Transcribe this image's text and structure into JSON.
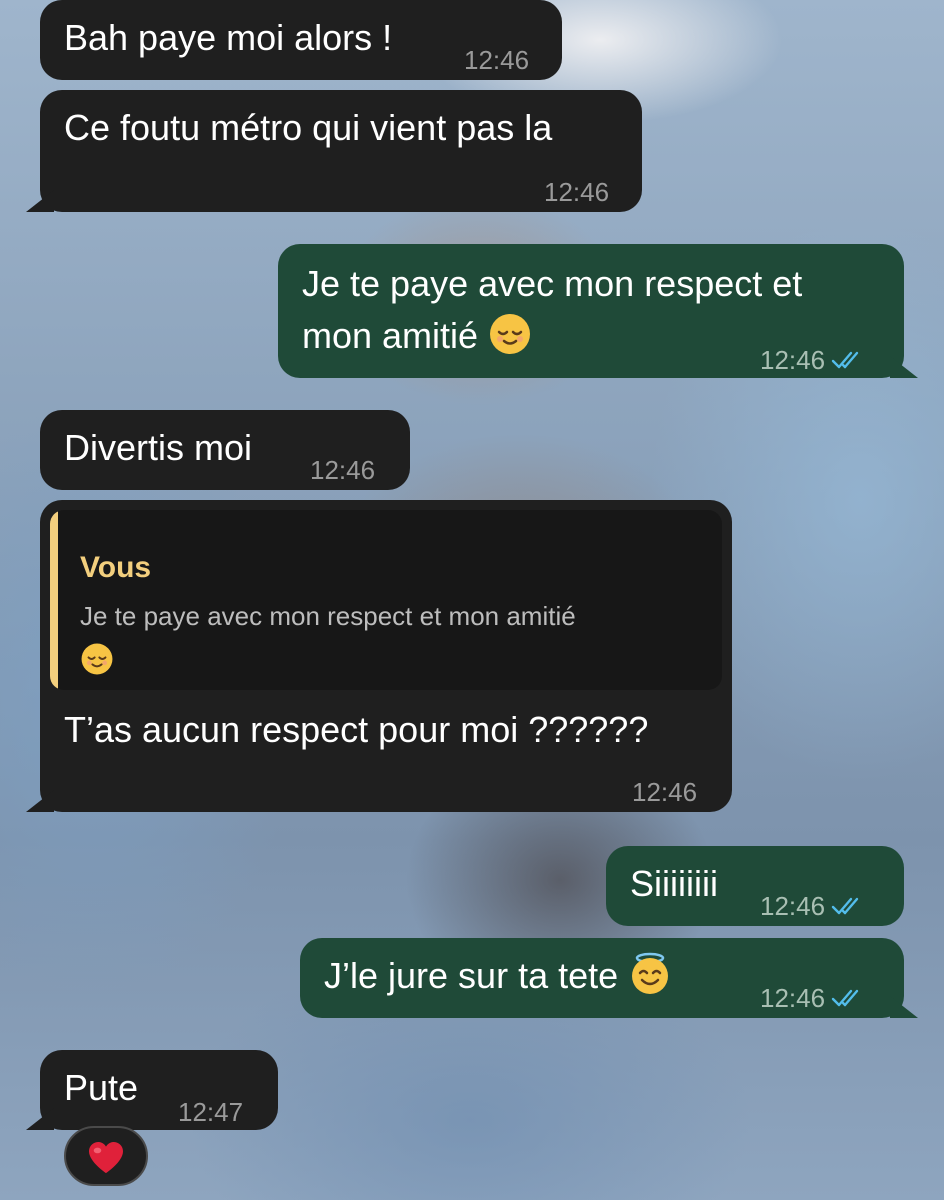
{
  "app": "WhatsApp chat",
  "colors": {
    "incoming_bubble": "#1f1f1f",
    "outgoing_bubble": "#1f4a38",
    "quote_accent": "#f3cf7e",
    "read_ticks": "#53bdeb",
    "heart": "#e0213a"
  },
  "messages": [
    {
      "direction": "in",
      "text": "Bah paye moi alors !",
      "time": "12:46"
    },
    {
      "direction": "in",
      "text": "Ce foutu métro qui vient pas la",
      "time": "12:46"
    },
    {
      "direction": "out",
      "line1": "Je te paye avec mon respect et",
      "line2": "mon amitié",
      "emoji": "relieved-face",
      "time": "12:46",
      "status": "read"
    },
    {
      "direction": "in",
      "text": "Divertis moi",
      "time": "12:46"
    },
    {
      "direction": "in",
      "quote": {
        "author": "Vous",
        "line1": "Je te paye avec mon respect et mon amitié",
        "emoji": "relieved-face"
      },
      "text": "T’as aucun respect pour moi ??????",
      "time": "12:46"
    },
    {
      "direction": "out",
      "text": "Siiiiiiii",
      "time": "12:46",
      "status": "read"
    },
    {
      "direction": "out",
      "text": "J’le jure sur ta tete",
      "emoji": "smiling-face-with-halo",
      "time": "12:46",
      "status": "read"
    },
    {
      "direction": "in",
      "text": "Pute",
      "time": "12:47",
      "reaction": "❤️"
    }
  ]
}
